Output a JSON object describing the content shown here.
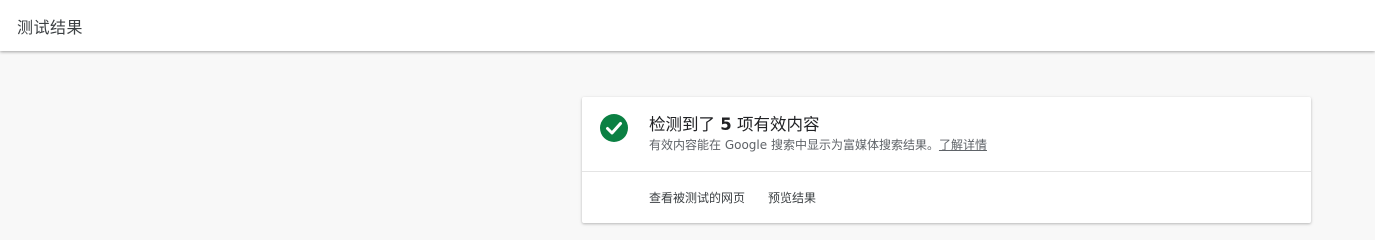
{
  "header": {
    "title": "测试结果"
  },
  "result_card": {
    "heading_prefix": "检测到了 ",
    "count": "5",
    "heading_suffix": " 项有效内容",
    "description": "有效内容能在 Google 搜索中显示为富媒体搜索结果。",
    "learn_more": "了解详情",
    "status_icon": "check-circle-icon",
    "status_color": "#0b8043",
    "actions": {
      "view_tested_page": "查看被测试的网页",
      "preview_result": "预览结果"
    }
  }
}
